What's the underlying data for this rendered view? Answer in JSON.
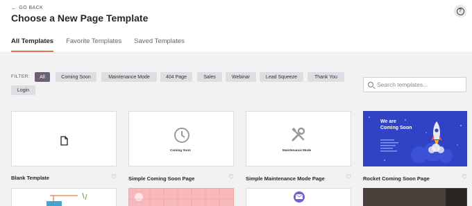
{
  "header": {
    "go_back": "GO BACK",
    "title": "Choose a New Page Template"
  },
  "tabs": [
    {
      "label": "All Templates",
      "active": true
    },
    {
      "label": "Favorite Templates",
      "active": false
    },
    {
      "label": "Saved Templates",
      "active": false
    }
  ],
  "filter": {
    "label": "FILTER:",
    "chips": [
      "All",
      "Coming Soon",
      "Maintenance Mode",
      "404 Page",
      "Sales",
      "Webinar",
      "Lead Squeeze",
      "Thank You",
      "Login"
    ],
    "active": "All"
  },
  "search": {
    "placeholder": "Search templates..."
  },
  "templates": [
    {
      "name": "Blank Template",
      "icon": "file-icon"
    },
    {
      "name": "Simple Coming Soon Page",
      "thumb_text": "Coming Soon",
      "icon": "clock-icon"
    },
    {
      "name": "Simple Maintenance Mode Page",
      "thumb_text": "Maintenance Mode",
      "icon": "tools-icon"
    },
    {
      "name": "Rocket Coming Soon Page",
      "thumb_text": "We are Coming Soon",
      "icon": "rocket-icon"
    }
  ],
  "colors": {
    "accent": "#e86e4e",
    "active_chip": "#6d6073",
    "chip": "#dddde3",
    "rocket_bg": "#2f43c4"
  }
}
